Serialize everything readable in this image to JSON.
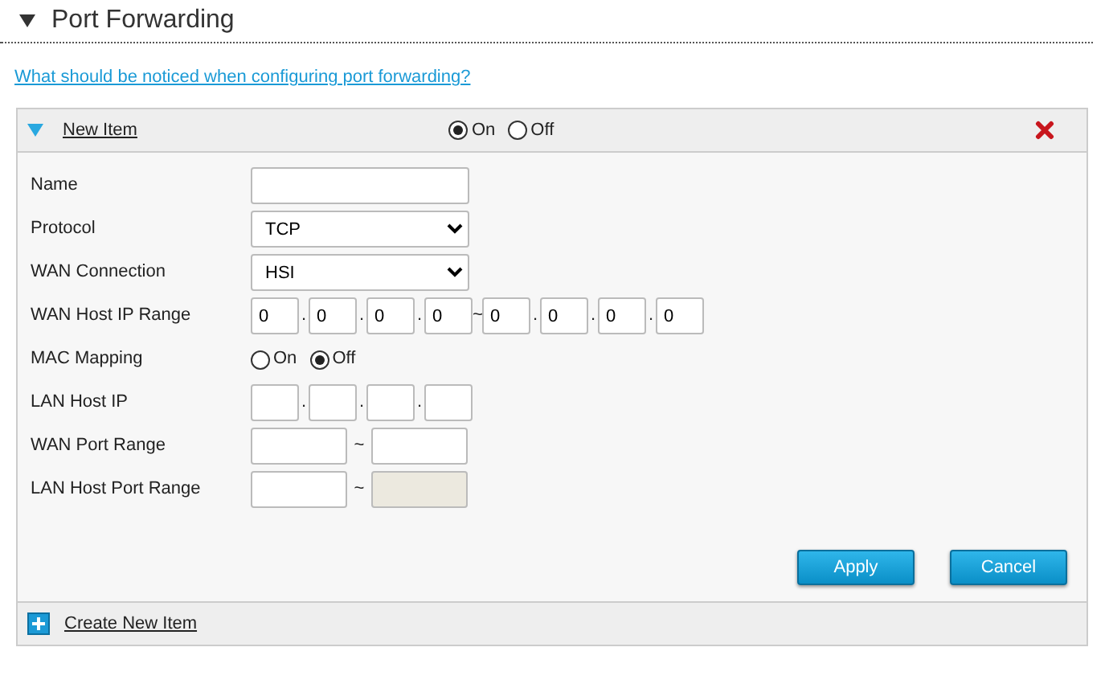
{
  "section": {
    "title": "Port Forwarding",
    "expanded": true
  },
  "help_link": "What should be noticed when configuring port forwarding?",
  "item": {
    "title": "New Item",
    "expanded": true,
    "enable": [
      {
        "label": "On",
        "selected": true
      },
      {
        "label": "Off",
        "selected": false
      }
    ],
    "fields": [
      {
        "kind": "text",
        "label": "Name"
      },
      {
        "kind": "select",
        "label": "Protocol",
        "value": "TCP"
      },
      {
        "kind": "select",
        "label": "WAN Connection",
        "value": "HSI"
      },
      {
        "kind": "ip_range",
        "label": "WAN Host IP Range",
        "parts": [
          {
            "value": "0"
          },
          {
            "sep": ".",
            "value": "0"
          },
          {
            "sep": ".",
            "value": "0"
          },
          {
            "sep": ".",
            "value": "0"
          },
          {
            "sep": "~",
            "value": "0"
          },
          {
            "sep": ".",
            "value": "0"
          },
          {
            "sep": ".",
            "value": "0"
          },
          {
            "sep": ".",
            "value": "0"
          }
        ]
      },
      {
        "kind": "radio",
        "label": "MAC Mapping",
        "options": [
          {
            "label": "On",
            "selected": false
          },
          {
            "label": "Off",
            "selected": true
          }
        ]
      },
      {
        "kind": "ip",
        "label": "LAN Host IP",
        "parts": [
          {
            "disabled": false
          },
          {
            "sep": ".",
            "disabled": false
          },
          {
            "sep": ".",
            "disabled": false
          },
          {
            "sep": ".",
            "disabled": false
          }
        ]
      },
      {
        "kind": "port_range",
        "label": "WAN Port Range",
        "parts": [
          {
            "disabled": false
          },
          {
            "sep": "~",
            "disabled": false
          }
        ]
      },
      {
        "kind": "port_range",
        "label": "LAN Host Port Range",
        "parts": [
          {
            "disabled": false
          },
          {
            "sep": "~",
            "disabled": true
          }
        ]
      }
    ],
    "buttons": [
      "Apply",
      "Cancel"
    ]
  },
  "create_link": "Create New Item"
}
